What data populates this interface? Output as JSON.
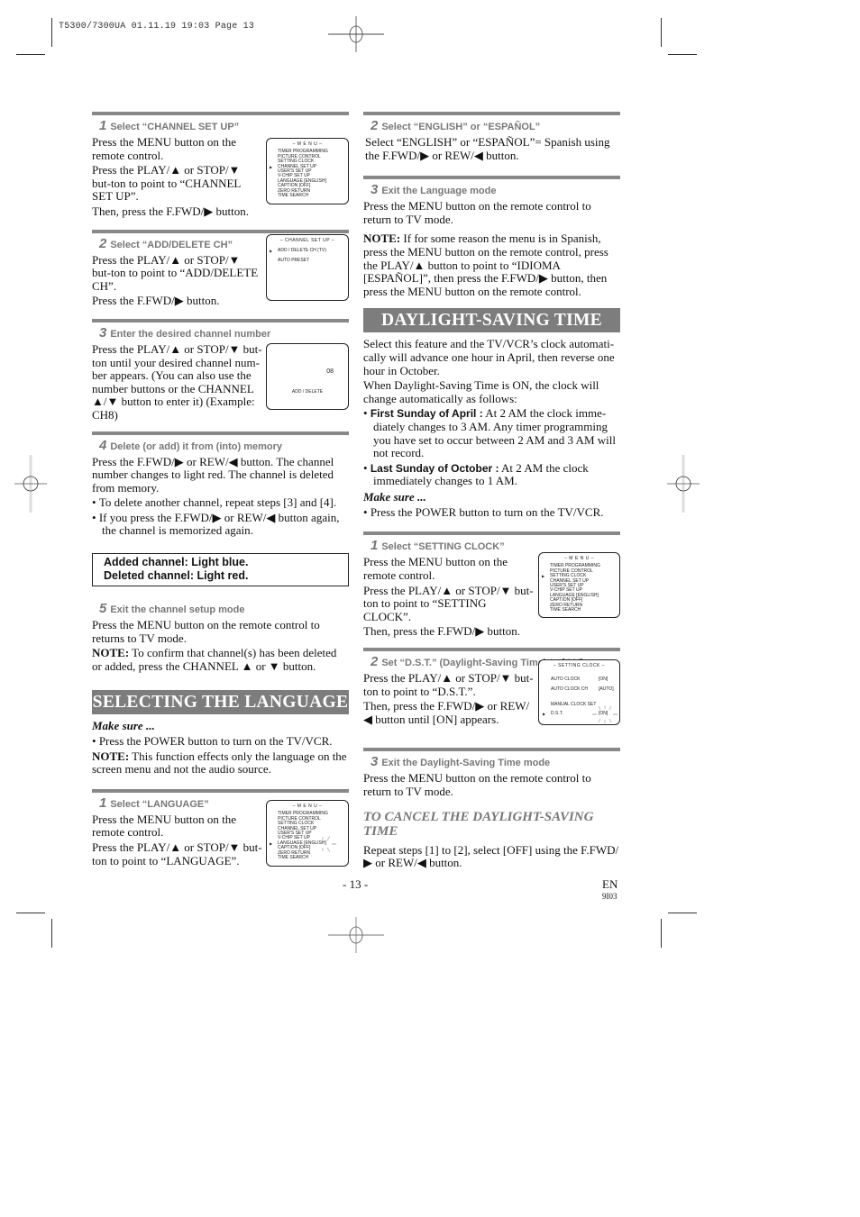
{
  "slug": "T5300/7300UA  01.11.19 19:03  Page 13",
  "left_column": {
    "steps_channel": [
      {
        "num": "1",
        "title": "Select “CHANNEL SET UP”",
        "paras": [
          "Press the MENU button on the remote control.",
          "Press the PLAY/▲ or STOP/▼ but-ton to point to “CHANNEL SET UP”.",
          "Then, press the F.FWD/▶ button."
        ]
      },
      {
        "num": "2",
        "title": "Select “ADD/DELETE CH”",
        "paras": [
          "Press the PLAY/▲ or STOP/▼ but-ton to point to “ADD/DELETE CH”.",
          "Press the F.FWD/▶ button."
        ]
      },
      {
        "num": "3",
        "title": "Enter the desired channel number",
        "paras": [
          "Press the PLAY/▲ or STOP/▼ but-ton until your desired channel num-ber appears. (You can also use the number buttons  or the CHANNEL ▲/▼ button to enter it) (Example: CH8)"
        ]
      },
      {
        "num": "4",
        "title": "Delete (or add) it from (into) memory",
        "paras": [
          "Press the F.FWD/▶ or REW/◀ button. The channel number changes to light red. The channel is deleted from memory."
        ],
        "bullets": [
          "To delete another channel, repeat steps [3] and [4].",
          "If you press the F.FWD/▶ or REW/◀ button again, the channel is memorized again."
        ]
      }
    ],
    "note_box": {
      "line1": "Added channel: Light blue.",
      "line2": "Deleted channel: Light red."
    },
    "step5": {
      "num": "5",
      "title": "Exit the channel setup mode",
      "para": "Press the MENU button on the remote control to returns to TV mode.",
      "note_label": "NOTE:",
      "note_text": " To confirm that channel(s) has been deleted or added, press the CHANNEL ▲ or ▼ button."
    },
    "language_banner": "SELECTING THE LANGUAGE",
    "make_sure": "Make sure ...",
    "make_sure_bullet": "Press the POWER button to turn on the TV/VCR.",
    "lang_note_label": "NOTE:",
    "lang_note_text": " This function effects only the language on the screen menu and not the audio source.",
    "lang_step1": {
      "num": "1",
      "title": "Select “LANGUAGE”",
      "paras": [
        "Press the MENU button on the remote control.",
        "Press the PLAY/▲ or STOP/▼ but-ton to point to “LANGUAGE”."
      ]
    }
  },
  "right_column": {
    "lang_step2": {
      "num": "2",
      "title": "Select “ENGLISH” or “ESPAÑOL”",
      "para": "Select “ENGLISH” or “ESPAÑOL”= Spanish using the F.FWD/▶ or REW/◀ button."
    },
    "lang_step3": {
      "num": "3",
      "title": "Exit the Language mode",
      "para": "Press the MENU button on the remote control to return to TV mode."
    },
    "lang_note_label": "NOTE:",
    "lang_note_text": " If for some reason the menu is in Spanish, press the MENU button on the remote control, press the PLAY/▲ button to point to “IDIOMA [ESPAÑOL]”, then press the F.FWD/▶ button, then press the MENU button on the remote control.",
    "dst_banner": "DAYLIGHT-SAVING TIME",
    "dst_intro1": "Select this feature and the TV/VCR’s clock automati-cally will advance one hour in April, then reverse one hour in October.",
    "dst_intro2": "When Daylight-Saving Time is ON, the clock will change automatically as follows:",
    "dst_bullets": [
      {
        "label": "First Sunday of April :",
        "text": " At 2 AM the clock imme-diately changes to 3 AM. Any timer programming you have set to occur between 2 AM and 3 AM will not record."
      },
      {
        "label": "Last Sunday of October :",
        "text": " At 2 AM the clock immediately changes to 1 AM."
      }
    ],
    "make_sure": "Make sure ...",
    "make_sure_bullet": "Press the POWER button to turn on the TV/VCR.",
    "dst_step1": {
      "num": "1",
      "title": "Select “SETTING CLOCK”",
      "paras": [
        "Press the MENU button on the remote control.",
        "Press the PLAY/▲ or STOP/▼ but-ton to point to “SETTING CLOCK”.",
        "Then, press the F.FWD/▶ button."
      ]
    },
    "dst_step2": {
      "num": "2",
      "title": "Set “D.S.T.” (Daylight-Saving Time) to [ON]",
      "paras": [
        "Press the PLAY/▲ or STOP/▼ but-ton to point to “D.S.T.”.",
        "Then, press the F.FWD/▶ or REW/◀ button until [ON] appears."
      ]
    },
    "dst_step3": {
      "num": "3",
      "title": "Exit the Daylight-Saving Time mode",
      "para": "Press the MENU button on the remote control to return to TV mode."
    },
    "cancel_heading": "TO CANCEL THE DAYLIGHT-SAVING TIME",
    "cancel_text": "Repeat steps [1] to [2], select [OFF] using the F.FWD/▶ or REW/◀ button."
  },
  "screens": {
    "main_menu": {
      "title": "– M E N U –",
      "items": [
        "TIMER PROGRAMMING",
        "PICTURE CONTROL",
        "SETTING CLOCK",
        "CHANNEL SET UP",
        "USER'S SET UP",
        "V-CHIP SET UP",
        "LANGUAGE  [ENGLISH]",
        "CAPTION  [OFF]",
        "ZERO RETURN",
        "TIME SEARCH"
      ]
    },
    "channel_setup": {
      "title": "– CHANNEL SET UP –",
      "items": [
        "ADD / DELETE CH (TV)",
        "AUTO PRESET"
      ]
    },
    "add_delete": {
      "channel": "08",
      "label": "ADD / DELETE"
    },
    "setting_clock": {
      "title": "– SETTING CLOCK –",
      "rows": [
        {
          "label": "AUTO CLOCK",
          "value": "[ON]"
        },
        {
          "label": "AUTO CLOCK CH",
          "value": "[AUTO]"
        },
        {
          "label": "MANUAL CLOCK SET",
          "value": ""
        },
        {
          "label": "D.S.T.",
          "value": "[ON]"
        }
      ]
    }
  },
  "footer": {
    "page_number": "- 13 -",
    "lang_code": "EN",
    "code": "9I03"
  }
}
